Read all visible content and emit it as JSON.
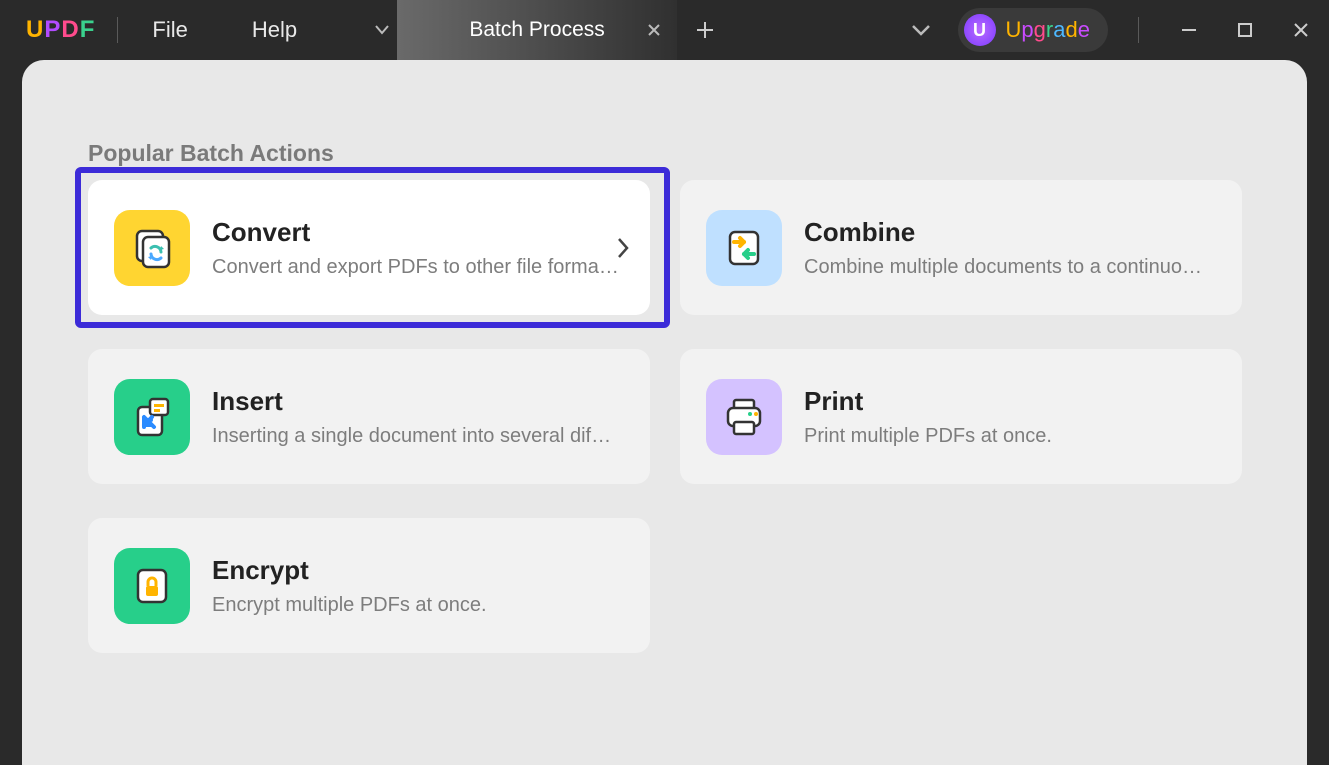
{
  "app": {
    "logo": "UPDF"
  },
  "menu": {
    "file": "File",
    "help": "Help"
  },
  "tab": {
    "title": "Batch Process"
  },
  "upgrade": {
    "letter": "U",
    "text": "Upgrade"
  },
  "section": {
    "title": "Popular Batch Actions"
  },
  "cards": {
    "convert": {
      "title": "Convert",
      "desc": "Convert and export PDFs to other file forma…"
    },
    "combine": {
      "title": "Combine",
      "desc": "Combine multiple documents to a continuo…"
    },
    "insert": {
      "title": "Insert",
      "desc": "Inserting a single document into several dif…"
    },
    "print": {
      "title": "Print",
      "desc": "Print multiple PDFs at once."
    },
    "encrypt": {
      "title": "Encrypt",
      "desc": "Encrypt multiple PDFs at once."
    }
  }
}
